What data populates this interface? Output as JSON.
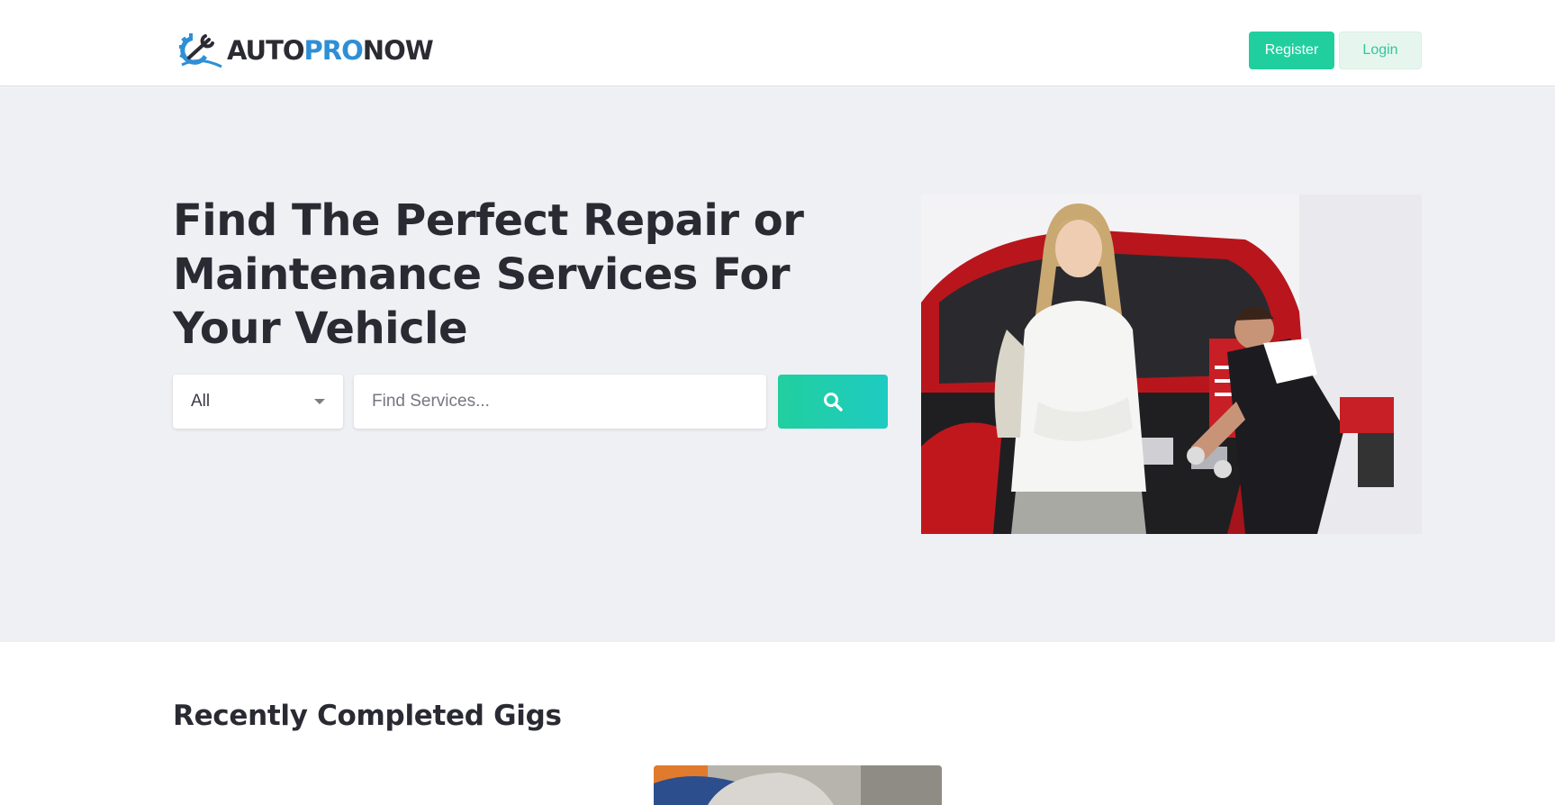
{
  "header": {
    "logo": {
      "part1": "AUTO",
      "part2": "PRO",
      "part3": "NOW"
    },
    "register_label": "Register",
    "login_label": "Login"
  },
  "hero": {
    "title": "Find The Perfect Repair or Maintenance Services For Your Vehicle",
    "category_select": {
      "selected": "All"
    },
    "search": {
      "placeholder": "Find Services..."
    },
    "search_button_icon": "search-icon",
    "image_subject": "mechanic-with-customer"
  },
  "recent": {
    "title": "Recently Completed Gigs"
  },
  "colors": {
    "accent": "#21cf9e",
    "accent_light": "#e6f6ef",
    "brand_blue": "#2e8fd6",
    "hero_bg": "#eff0f4",
    "text_dark": "#2a2a33"
  }
}
